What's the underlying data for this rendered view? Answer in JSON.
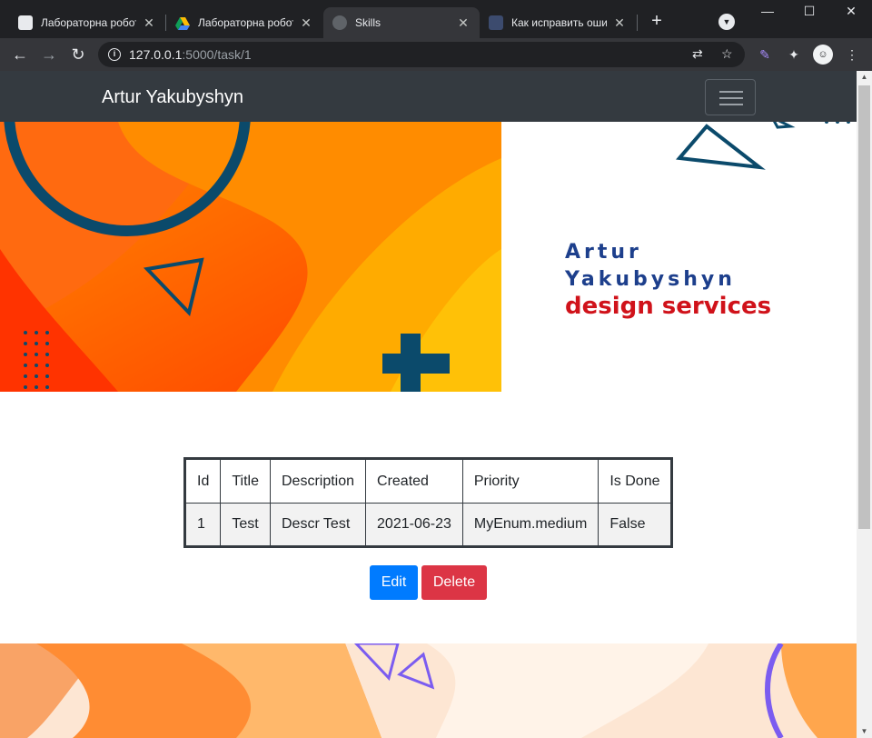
{
  "browser": {
    "tabs": [
      {
        "title": "Лабораторна робот",
        "favicon": "document-icon",
        "active": false
      },
      {
        "title": "Лабораторна робот",
        "favicon": "google-drive-icon",
        "active": false
      },
      {
        "title": "Skills",
        "favicon": "globe-icon",
        "active": true
      },
      {
        "title": "Как исправить ошиб",
        "favicon": "stackoverflow-icon",
        "active": false
      }
    ],
    "url_host": "127.0.0.1",
    "url_rest": ":5000/task/1"
  },
  "site": {
    "brand": "Artur Yakubyshyn",
    "logo": {
      "line1": "Artur",
      "line2": "Yakubyshyn",
      "line3": "design services"
    }
  },
  "table": {
    "headers": [
      "Id",
      "Title",
      "Description",
      "Created",
      "Priority",
      "Is Done"
    ],
    "rows": [
      [
        "1",
        "Test",
        "Descr Test",
        "2021-06-23",
        "MyEnum.medium",
        "False"
      ]
    ]
  },
  "actions": {
    "edit_label": "Edit",
    "delete_label": "Delete"
  },
  "colors": {
    "navbar": "#343a40",
    "edit_button": "#007bff",
    "delete_button": "#dc3545",
    "logo_blue": "#1d3f8c",
    "logo_red": "#d0121a",
    "hero_orange": "#ff6a00",
    "hero_navy": "#0b4a6b"
  }
}
